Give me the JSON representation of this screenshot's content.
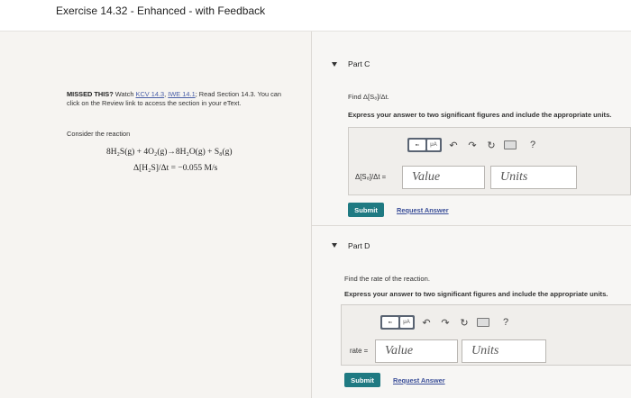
{
  "header": {
    "title": "Exercise 14.32 - Enhanced - with Feedback"
  },
  "left": {
    "missed_bold": "MISSED THIS?",
    "missed_watch": " Watch ",
    "link_kcv": "KCV 14.3",
    "comma": ", ",
    "link_iwe": "IWE 14.1",
    "missed_rest": "; Read Section 14.3. You can click on the Review link to access the section in your eText.",
    "consider": "Consider the reaction",
    "eq_reaction": "8H₂S(g) + 4O₂(g)→8H₂O(g) + S₈(g)",
    "eq_rate": "Δ[H₂S]/Δt = −0.055 M/s"
  },
  "partC": {
    "title": "Part C",
    "find": "Find Δ[S₈]/Δt.",
    "instruction": "Express your answer to two significant figures and include the appropriate units.",
    "eq_label": "Δ[S₈]/Δt =",
    "value_placeholder": "Value",
    "units_placeholder": "Units",
    "submit": "Submit",
    "request": "Request Answer",
    "tb_mu": "μA",
    "tb_help": "?"
  },
  "partD": {
    "title": "Part D",
    "find": "Find the rate of the reaction.",
    "instruction": "Express your answer to two significant figures and include the appropriate units.",
    "eq_label": "rate =",
    "value_placeholder": "Value",
    "units_placeholder": "Units",
    "submit": "Submit",
    "request": "Request Answer",
    "tb_mu": "μA",
    "tb_help": "?"
  }
}
